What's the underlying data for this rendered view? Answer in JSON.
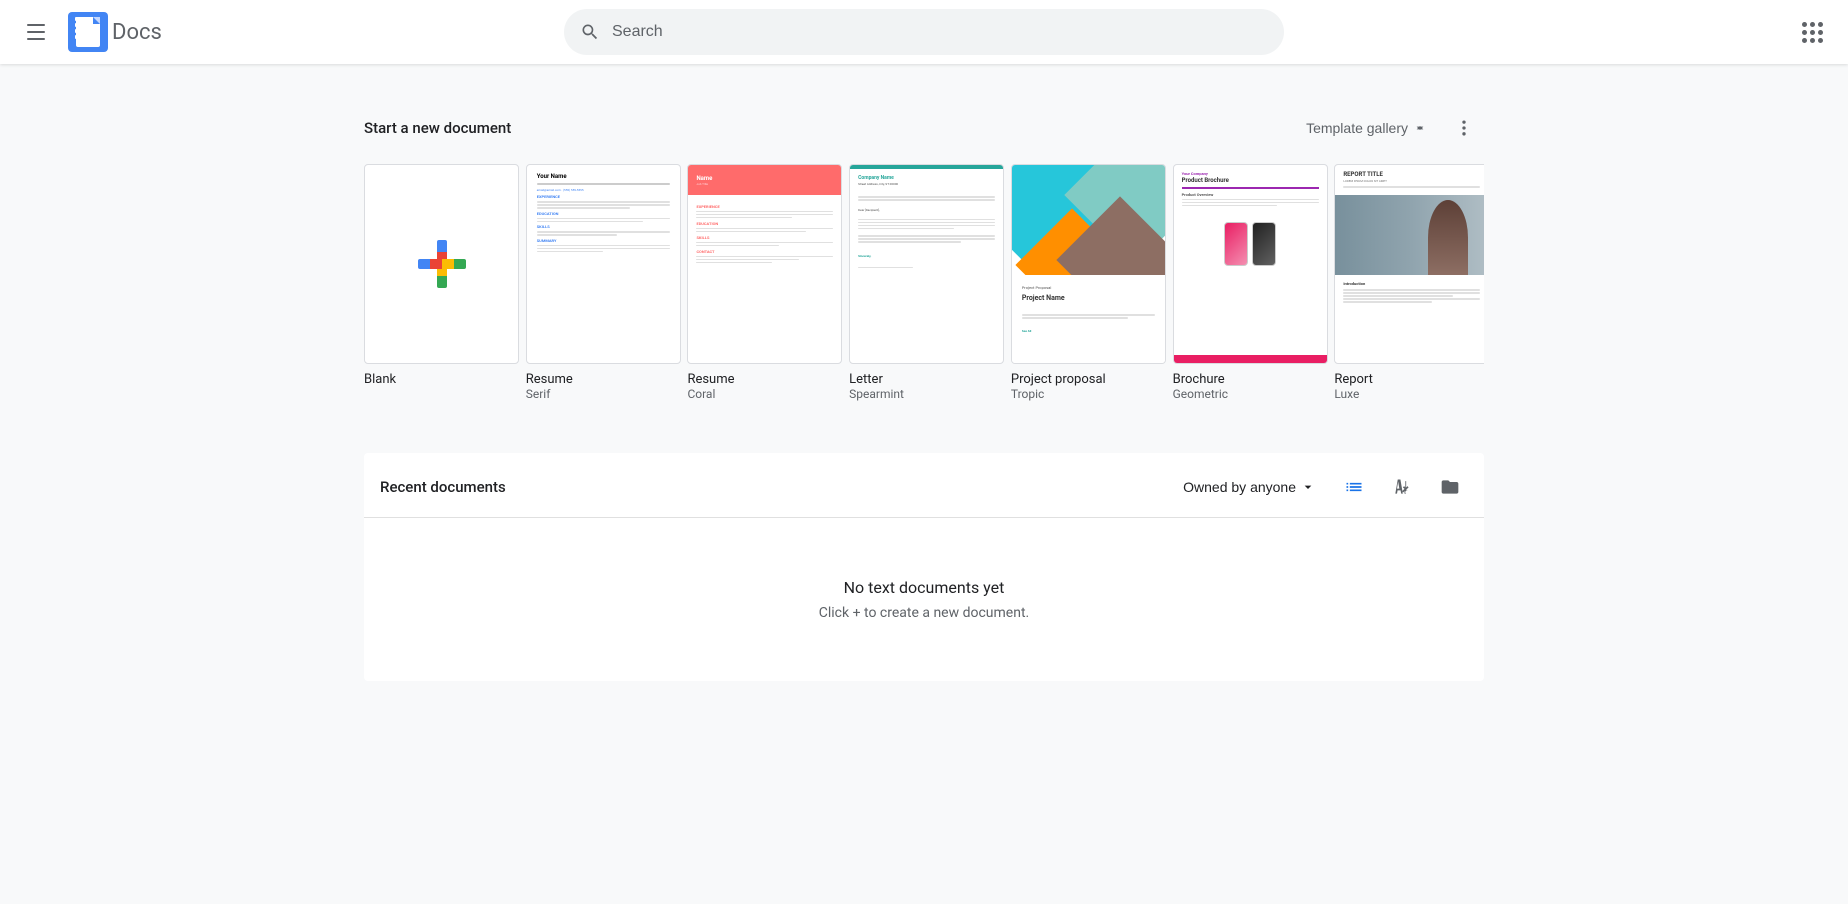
{
  "app": {
    "name": "Docs",
    "logo_bg": "#4285f4"
  },
  "header": {
    "menu_label": "Main menu",
    "search_placeholder": "Search",
    "apps_label": "Google apps"
  },
  "template_section": {
    "title": "Start a new document",
    "gallery_label": "Template gallery",
    "more_label": "More options",
    "templates": [
      {
        "id": "blank",
        "name": "Blank",
        "subname": ""
      },
      {
        "id": "resume-serif",
        "name": "Resume",
        "subname": "Serif"
      },
      {
        "id": "resume-coral",
        "name": "Resume",
        "subname": "Coral"
      },
      {
        "id": "letter-spearmint",
        "name": "Letter",
        "subname": "Spearmint"
      },
      {
        "id": "project-proposal-tropic",
        "name": "Project proposal",
        "subname": "Tropic"
      },
      {
        "id": "brochure-geometric",
        "name": "Brochure",
        "subname": "Geometric"
      },
      {
        "id": "report-luxe",
        "name": "Report",
        "subname": "Luxe"
      }
    ]
  },
  "recent_section": {
    "title": "Recent documents",
    "owned_by_label": "Owned by anyone",
    "empty_title": "No text documents yet",
    "empty_subtitle": "Click + to create a new document.",
    "view_list_label": "List view",
    "view_az_label": "Sort options",
    "view_folder_label": "Open file picker"
  }
}
